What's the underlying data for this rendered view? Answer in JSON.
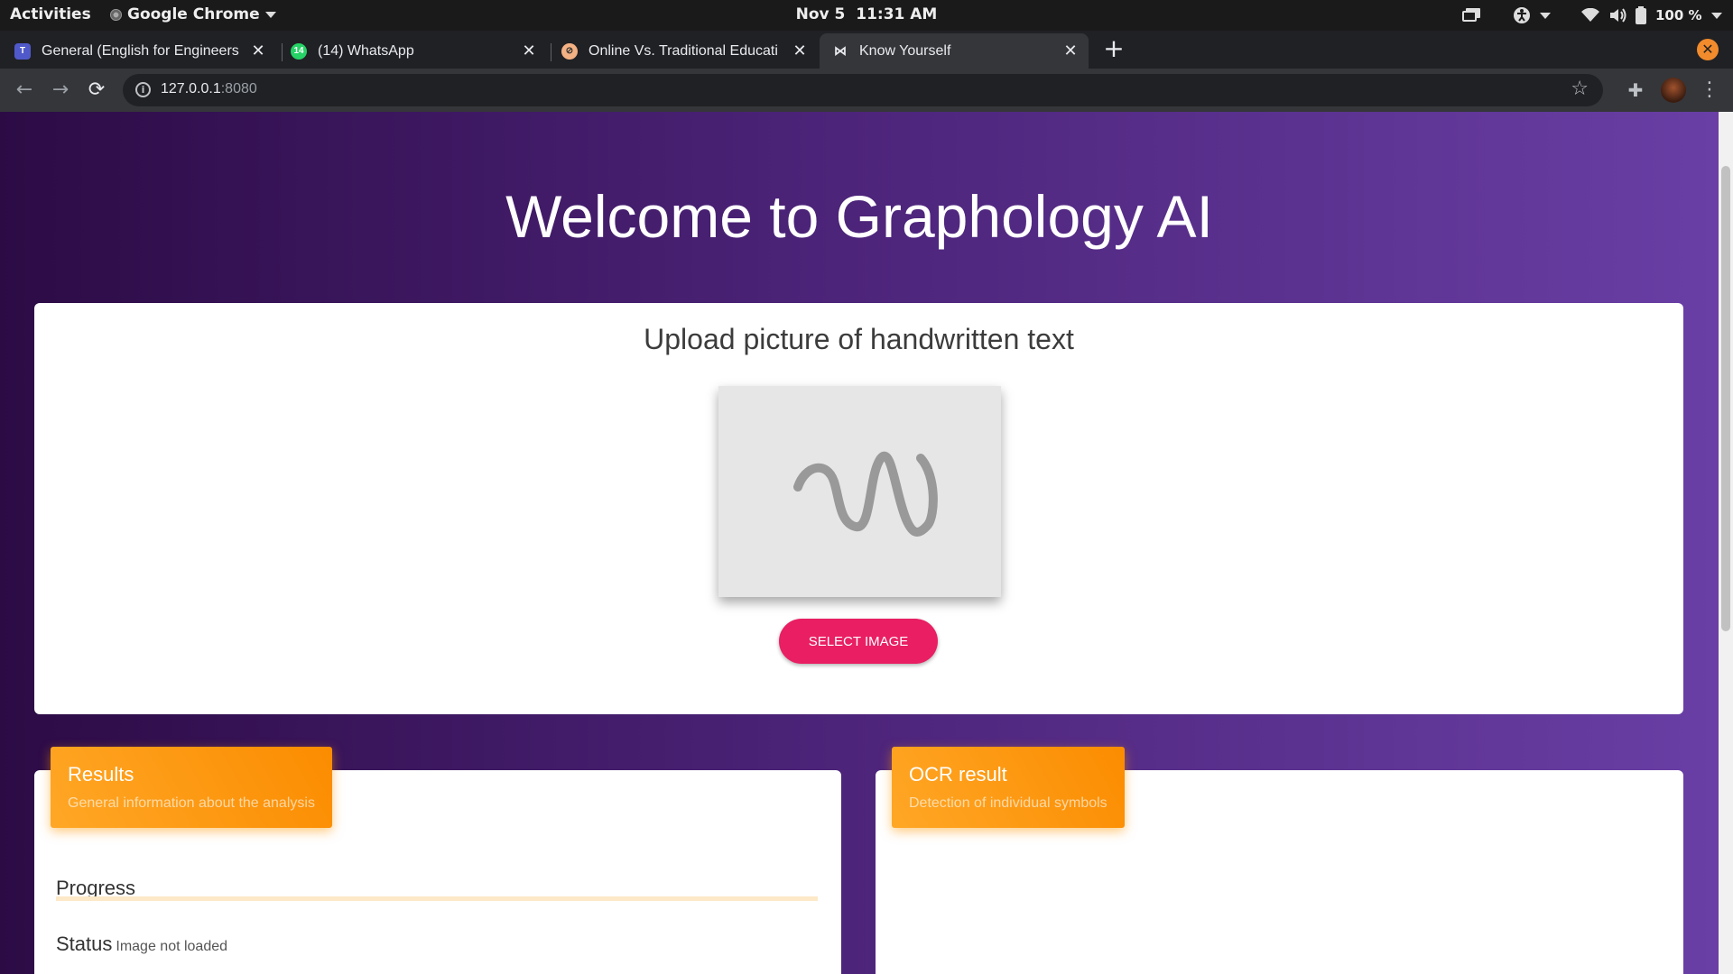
{
  "system_bar": {
    "activities": "Activities",
    "app_name": "Google Chrome",
    "date": "Nov 5",
    "time": "11:31 AM",
    "battery": "100 %"
  },
  "browser": {
    "tabs": [
      {
        "label": "General (English for Engineers",
        "favicon": "teams-icon",
        "active": false
      },
      {
        "label": "(14) WhatsApp",
        "favicon": "whatsapp-icon",
        "badge": "14",
        "active": false
      },
      {
        "label": "Online Vs. Traditional Educati",
        "favicon": "compass-icon",
        "active": false
      },
      {
        "label": "Know Yourself",
        "favicon": "bowtie-icon",
        "active": true
      }
    ],
    "url_host": "127.0.0.1",
    "url_port": ":8080"
  },
  "page": {
    "title": "Welcome to Graphology AI",
    "upload": {
      "heading": "Upload picture of handwritten text",
      "button_label": "SELECT IMAGE"
    },
    "results": {
      "header": "Results",
      "subheader": "General information about the analysis",
      "progress_label": "Progress",
      "progress_fraction": 0,
      "status_label": "Status",
      "status_value": "Image not loaded"
    },
    "ocr": {
      "header": "OCR result",
      "subheader": "Detection of individual symbols"
    }
  },
  "colors": {
    "accent_pink": "#e91e63",
    "header_orange": "#fb8c00",
    "background_purple": "#4a2276"
  }
}
